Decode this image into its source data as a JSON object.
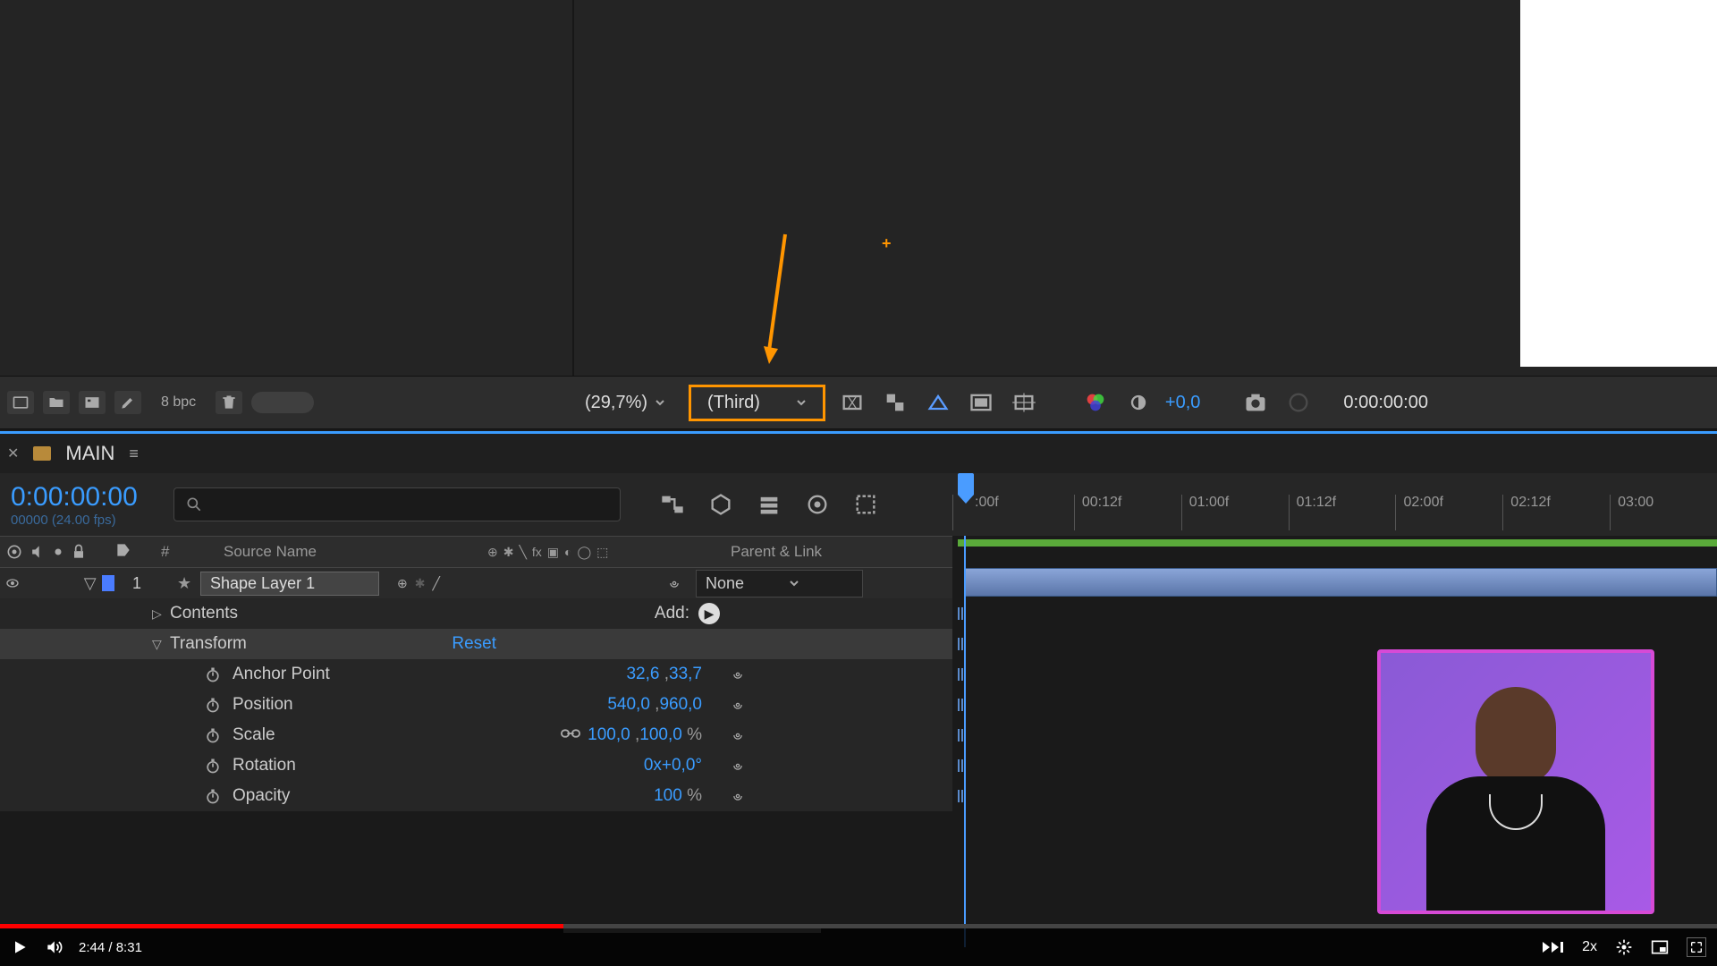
{
  "viewport": {
    "zoom_label": "(29,7%)",
    "resolution_label": "(Third)",
    "exposure": "+0,0",
    "timecode": "0:00:00:00"
  },
  "project_bar": {
    "bpc": "8 bpc"
  },
  "panel": {
    "name": "MAIN"
  },
  "timeline": {
    "current_time": "0:00:00:00",
    "frame_info": "00000 (24.00 fps)",
    "ruler": [
      ":00f",
      "00:12f",
      "01:00f",
      "01:12f",
      "02:00f",
      "02:12f",
      "03:00"
    ]
  },
  "columns": {
    "num": "#",
    "source": "Source Name",
    "parent": "Parent & Link"
  },
  "layer": {
    "index": "1",
    "name": "Shape Layer 1",
    "parent": "None"
  },
  "props": {
    "contents": "Contents",
    "add_label": "Add:",
    "transform": "Transform",
    "reset": "Reset",
    "anchor": {
      "label": "Anchor Point",
      "x": "32,6",
      "y": "33,7"
    },
    "position": {
      "label": "Position",
      "x": "540,0",
      "y": "960,0"
    },
    "scale": {
      "label": "Scale",
      "x": "100,0",
      "y": "100,0",
      "unit": "%"
    },
    "rotation": {
      "label": "Rotation",
      "value": "0x+0,0°"
    },
    "opacity": {
      "label": "Opacity",
      "value": "100",
      "unit": "%"
    }
  },
  "video": {
    "current": "2:44",
    "duration": "8:31",
    "speed": "2x"
  }
}
